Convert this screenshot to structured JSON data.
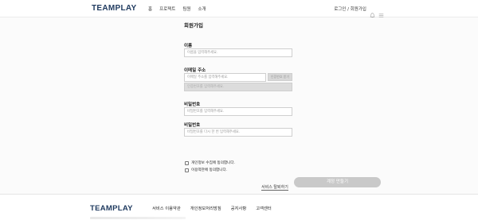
{
  "header": {
    "logo": "TEAMPLAY",
    "nav": [
      "홈",
      "프로젝트",
      "팀원",
      "소개"
    ],
    "login": "로그인 / 회원가입"
  },
  "form": {
    "title": "회원가입",
    "name_label": "이름",
    "name_placeholder": "이름을 입력해주세요.",
    "email_label": "이메일 주소",
    "email_placeholder": "이메일 주소를 입력해주세요.",
    "verify_button": "인증번호 받기",
    "code_placeholder": "인증번호를 입력해주세요.",
    "password_label": "비밀번호",
    "password_placeholder": "비밀번호를 입력해주세요.",
    "confirm_label": "비밀번호",
    "confirm_placeholder": "비밀번호를 다시 한 번 입력해주세요.",
    "agree_privacy": "개인정보 수집에 동의합니다.",
    "agree_terms": "이용약관에 동의합니다.",
    "more_link": "서비스 탈퇴하기",
    "submit": "계정 만들기"
  },
  "footer": {
    "logo": "TEAMPLAY",
    "links": [
      "서비스 이용약관",
      "개인정보처리방침",
      "공지사항",
      "고객센터"
    ]
  }
}
